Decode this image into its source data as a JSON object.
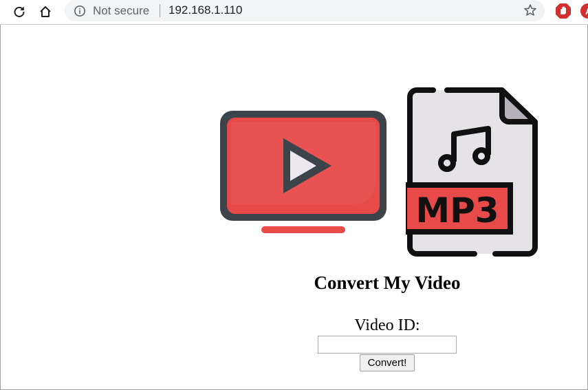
{
  "browser": {
    "security_label": "Not secure",
    "url": "192.168.1.110",
    "icons": [
      "reload-icon",
      "home-icon",
      "info-icon",
      "star-icon",
      "adblock-icon",
      "extension-icon"
    ],
    "extension2_letter": "A"
  },
  "hero": {
    "mp3_label": "MP3",
    "colors": {
      "red": "#e84a4a",
      "dark": "#3d4449",
      "light_gray": "#e6e3e8"
    }
  },
  "page": {
    "title": "Convert My Video",
    "video_label": "Video ID:",
    "video_input_value": "",
    "convert_label": "Convert!"
  }
}
